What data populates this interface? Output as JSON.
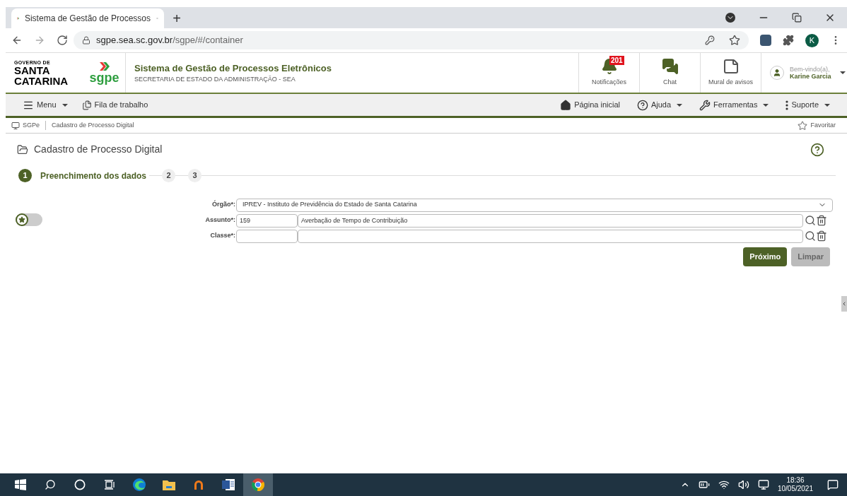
{
  "browser": {
    "tab_title": "Sistema de Gestão de Processos",
    "new_tab": "+",
    "url_host": "sgpe.sea.sc.gov.br",
    "url_path": "/sgpe/#/container",
    "profile_initial": "K"
  },
  "header": {
    "logo_top": "GOVERNO DE",
    "logo_line1": "SANTA",
    "logo_line2": "CATARINA",
    "app_logo": "sgpe",
    "title": "Sistema de Gestão de Processos Eletrônicos",
    "subtitle": "SECRETARIA DE ESTADO DA ADMINISTRAÇÃO - SEA",
    "actions": [
      {
        "kind": "bell",
        "label": "Notificações",
        "badge": "201"
      },
      {
        "kind": "chat",
        "label": "Chat"
      },
      {
        "kind": "board",
        "label": "Mural de avisos"
      }
    ],
    "user": {
      "greeting": "Bem-vindo(a),",
      "name": "Karine Garcia"
    }
  },
  "nav_left": [
    {
      "kind": "menu",
      "label": "Menu",
      "dropdown": true
    },
    {
      "kind": "queue",
      "label": "Fila de trabalho",
      "dropdown": false
    }
  ],
  "nav_right": [
    {
      "kind": "home",
      "label": "Página inicial",
      "dropdown": false
    },
    {
      "kind": "help",
      "label": "Ajuda",
      "dropdown": true
    },
    {
      "kind": "tools",
      "label": "Ferramentas",
      "dropdown": true
    },
    {
      "kind": "support",
      "label": "Suporte",
      "dropdown": true
    }
  ],
  "breadcrumb": [
    "SGPe",
    "Cadastro de Processo Digital"
  ],
  "favorite": "Favoritar",
  "page_title": "Cadastro de Processo Digital",
  "steps": [
    {
      "number": "1",
      "label": "Preenchimento dos dados",
      "selected": true
    },
    {
      "number": "2",
      "selected": false
    },
    {
      "number": "3",
      "selected": false
    }
  ],
  "favorite_toggle": {
    "on": false
  },
  "form": [
    {
      "kind": "select",
      "label": "Órgão*:",
      "value": "IPREV - Instituto de Previdência do Estado de Santa Catarina"
    },
    {
      "kind": "lookup",
      "label": "Assunto*:",
      "code": "159",
      "value": "Averbação de Tempo de Contribuição"
    },
    {
      "kind": "lookup",
      "label": "Classe*:"
    }
  ],
  "buttons": [
    {
      "label": "Próximo",
      "disabled": false
    },
    {
      "label": "Limpar",
      "disabled": true
    }
  ],
  "taskbar": {
    "apps": [
      {
        "kind": "windows",
        "selected": false
      },
      {
        "kind": "search",
        "selected": false
      },
      {
        "kind": "cortana",
        "selected": false
      },
      {
        "kind": "taskview",
        "selected": false
      },
      {
        "kind": "edge",
        "selected": false
      },
      {
        "kind": "files",
        "selected": false
      },
      {
        "kind": "orange",
        "selected": false
      },
      {
        "kind": "word",
        "selected": false
      },
      {
        "kind": "chrome",
        "selected": true
      }
    ],
    "time": "18:36",
    "date": "10/05/2021"
  }
}
